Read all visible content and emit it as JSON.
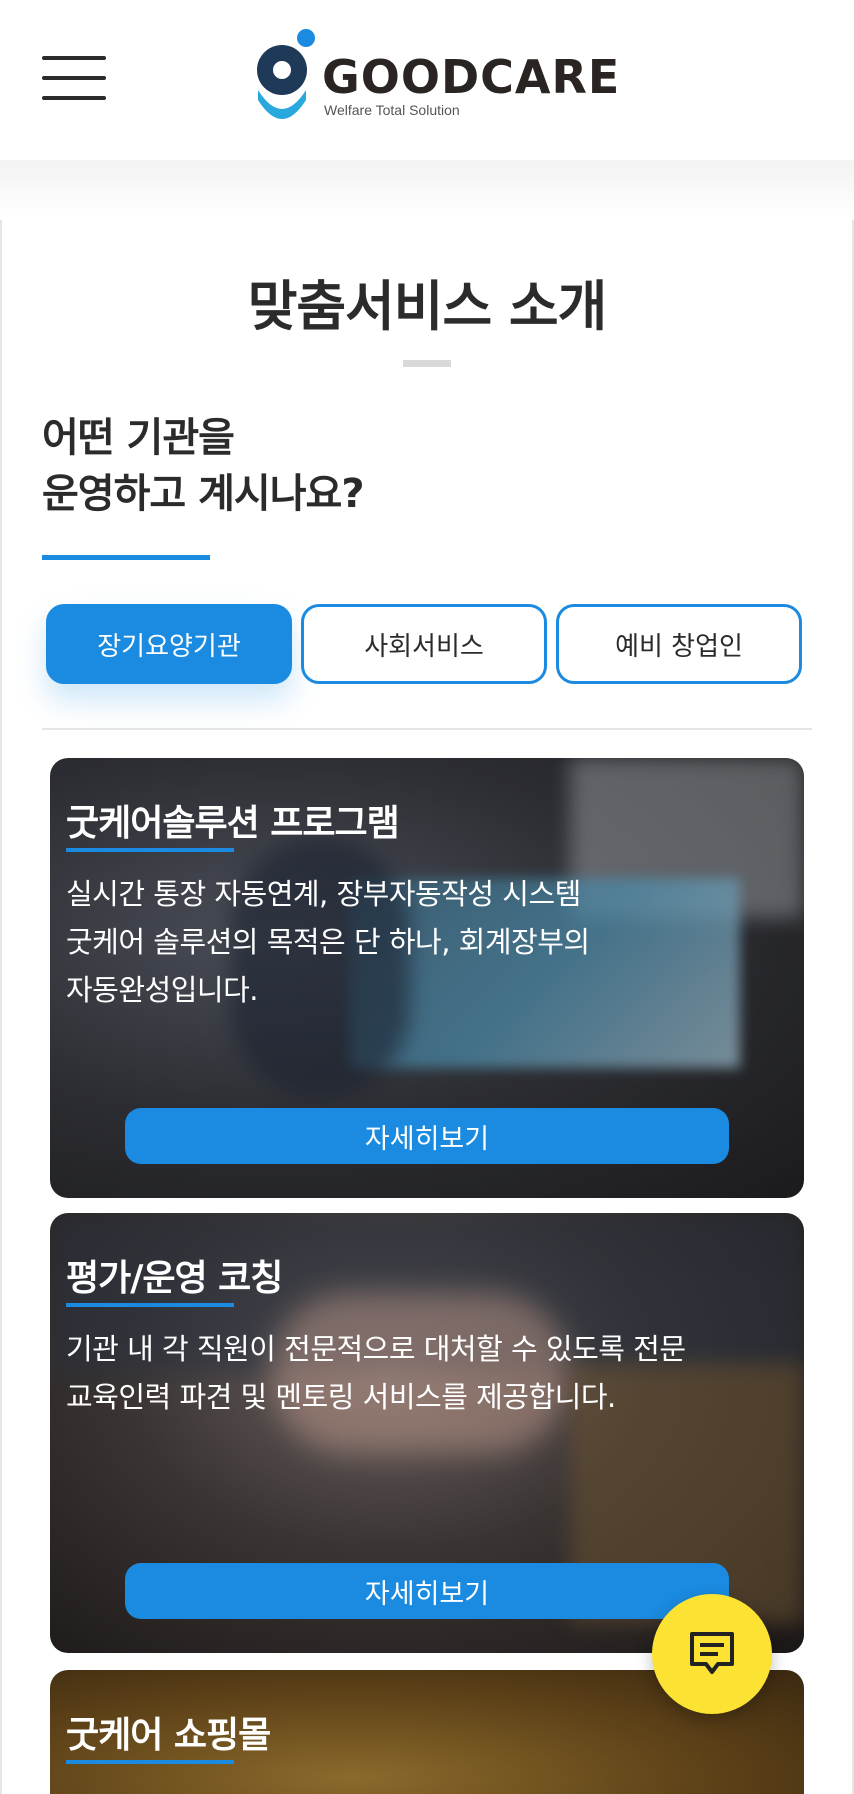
{
  "header": {
    "logo_text": "GOODCARE",
    "logo_subtitle": "Welfare Total Solution",
    "menu_icon": "hamburger-menu-icon"
  },
  "intro": {
    "title": "맞춤서비스 소개",
    "question_line1": "어떤 기관을",
    "question_line2": "운영하고 계시나요?"
  },
  "tabs": [
    {
      "label": "장기요양기관",
      "active": true
    },
    {
      "label": "사회서비스",
      "active": false
    },
    {
      "label": "예비 창업인",
      "active": false
    }
  ],
  "cards": [
    {
      "title": "굿케어솔루션 프로그램",
      "desc_line1": "실시간 통장 자동연계, 장부자동작성 시스템",
      "desc_line2": "굿케어 솔루션의 목적은 단 하나, 회계장부의",
      "desc_line3": "자동완성입니다.",
      "button": "자세히보기"
    },
    {
      "title": "평가/운영 코칭",
      "desc_line1": "기관 내 각 직원이 전문적으로 대처할 수 있도록 전문",
      "desc_line2": "교육인력 파견 및 멘토링 서비스를 제공합니다.",
      "button": "자세히보기"
    },
    {
      "title": "굿케어 쇼핑몰"
    }
  ],
  "chat": {
    "icon": "chat-message-icon"
  },
  "colors": {
    "accent": "#1a8be0",
    "chat": "#fbe233",
    "text_dark": "#2b2b2b"
  }
}
